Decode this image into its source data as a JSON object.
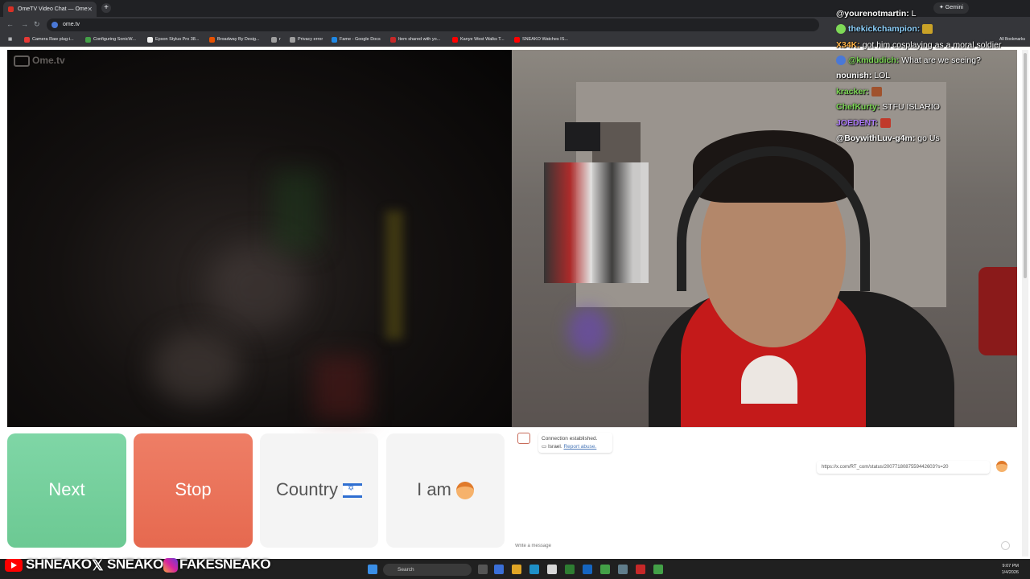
{
  "browser": {
    "tab_title": "OmeTV Video Chat — Ome",
    "new_tab_symbol": "+",
    "close_tab_symbol": "✕",
    "back_symbol": "←",
    "forward_symbol": "→",
    "reload_symbol": "↻",
    "url": "ome.tv",
    "gemini_label": "✦ Gemini",
    "bookmarks": [
      {
        "label": "Camera Raw plug-i...",
        "color": "#e53935"
      },
      {
        "label": "Configuring SonicW...",
        "color": "#43a047"
      },
      {
        "label": "Epson Stylus Pro 38...",
        "color": "#eeeeee"
      },
      {
        "label": "Broadway By Desig...",
        "color": "#e65100"
      },
      {
        "label": "r",
        "color": "#9e9e9e"
      },
      {
        "label": "Privacy error",
        "color": "#9e9e9e"
      },
      {
        "label": "Fame - Google Docs",
        "color": "#1e88e5"
      },
      {
        "label": "Item shared with yo...",
        "color": "#c62828"
      },
      {
        "label": "Kanye West Walks T...",
        "color": "#ff0000"
      },
      {
        "label": "SNEAKO Watches IS...",
        "color": "#ff0000"
      }
    ],
    "all_bookmarks_label": "All Bookmarks"
  },
  "ometv": {
    "logo_text": "Ome.tv",
    "buttons": {
      "next": "Next",
      "stop": "Stop",
      "country": "Country",
      "i_am": "I am"
    },
    "colors": {
      "next": "#6cc993",
      "stop": "#e6694f"
    },
    "chat": {
      "system_line1": "Connection established.",
      "system_country": "Israel.",
      "report_link": "Report abuse.",
      "my_message": "https://x.com/RT_com/status/2007718087559442603?s=20",
      "input_placeholder": "Write a message"
    }
  },
  "stream_chat": [
    {
      "user": "@yourenotmartin:",
      "message": "L",
      "color": "#ffffff"
    },
    {
      "user": "thekickchampion:",
      "message": "",
      "color": "#8fd3ff"
    },
    {
      "user": "X34K:",
      "message": "got him cosplaying as a moral soldier",
      "color": "#ffb347"
    },
    {
      "user": "@kmdudich:",
      "message": "What are we seeing?",
      "color": "#7ed957"
    },
    {
      "user": "nounish:",
      "message": "LOL",
      "color": "#ffffff"
    },
    {
      "user": "kracker:",
      "message": "",
      "color": "#7ed957"
    },
    {
      "user": "ChefKurty:",
      "message": "STFU ISLARIO",
      "color": "#7ed957"
    },
    {
      "user": "JOEDENT:",
      "message": "",
      "color": "#b07cff"
    },
    {
      "user": "@BoywithLuv-g4m:",
      "message": "go Us",
      "color": "#ffffff"
    }
  ],
  "banner": {
    "part1": "SHNEAKO",
    "x_symbol": "𝕏",
    "part2": "SNEAKO",
    "part3": "FAKESNEAKO"
  },
  "taskbar": {
    "search_label": "Search",
    "time": "9:07 PM",
    "date": "1/4/2026"
  }
}
